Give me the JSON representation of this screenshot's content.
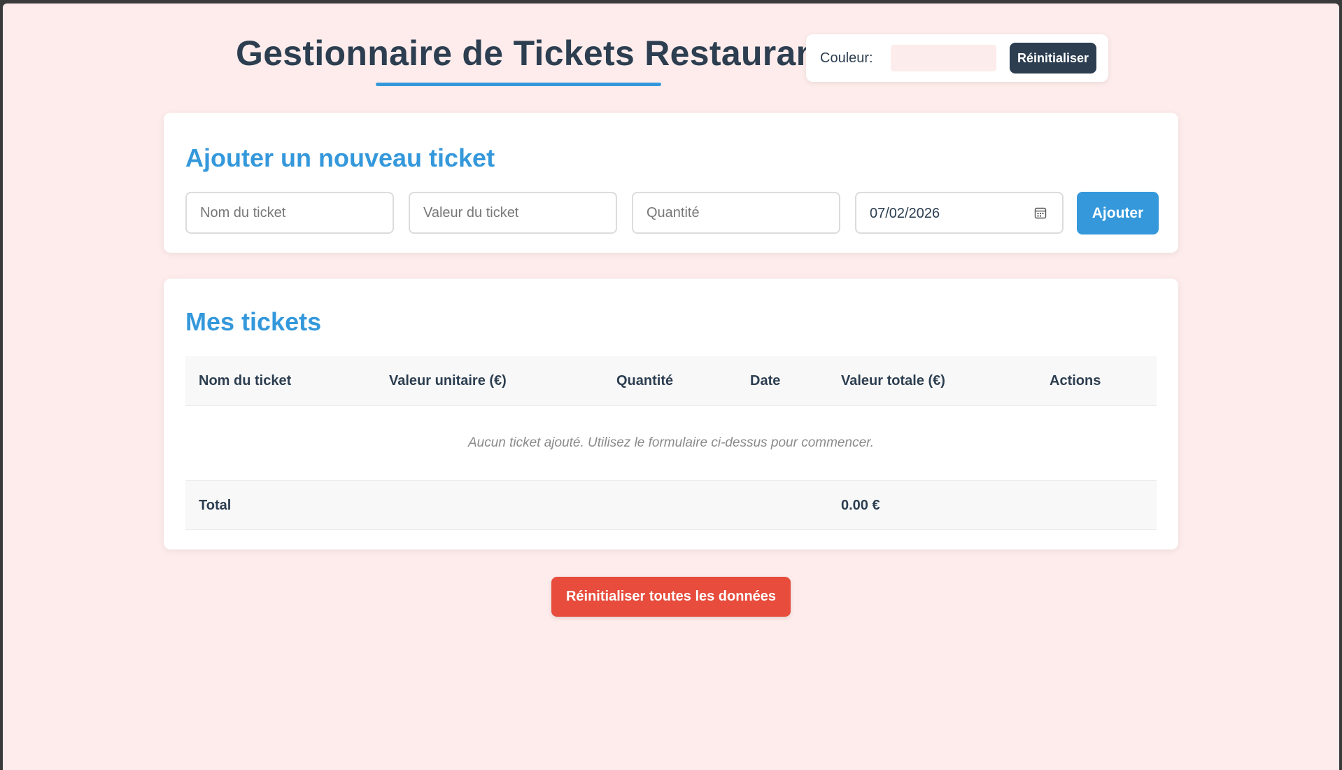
{
  "header": {
    "title": "Gestionnaire de Tickets Restaurant"
  },
  "color_widget": {
    "label": "Couleur:",
    "swatch_color": "#fdecec",
    "reset_label": "Réinitialiser"
  },
  "add_form": {
    "title": "Ajouter un nouveau ticket",
    "name_placeholder": "Nom du ticket",
    "value_placeholder": "Valeur du ticket",
    "quantity_placeholder": "Quantité",
    "date_value": "07/02/2026",
    "date_icon": "calendar-icon",
    "submit_label": "Ajouter"
  },
  "tickets": {
    "title": "Mes tickets",
    "columns": [
      "Nom du ticket",
      "Valeur unitaire (€)",
      "Quantité",
      "Date",
      "Valeur totale (€)",
      "Actions"
    ],
    "empty_message": "Aucun ticket ajouté. Utilisez le formulaire ci-dessus pour commencer.",
    "total_label": "Total",
    "total_value": "0.00 €"
  },
  "footer": {
    "reset_all_label": "Réinitialiser toutes les données"
  },
  "colors": {
    "background": "#fdeceb",
    "accent": "#3498db",
    "dark": "#2c3e50",
    "danger": "#e74c3c"
  }
}
